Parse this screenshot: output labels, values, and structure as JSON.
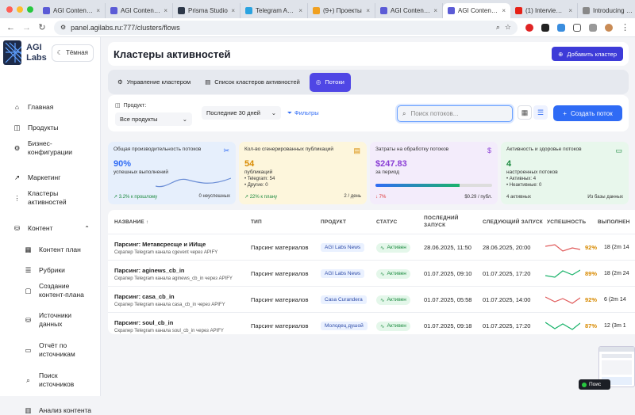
{
  "browser": {
    "tabs": [
      {
        "label": "AGI Content B...",
        "color": "#5b5bd6"
      },
      {
        "label": "AGI Content B...",
        "color": "#5b5bd6"
      },
      {
        "label": "Prisma Studio",
        "color": "#2d3748"
      },
      {
        "label": "Telegram API ...",
        "color": "#2aa3e0"
      },
      {
        "label": "(9+) Проекты",
        "color": "#f0a020"
      },
      {
        "label": "AGI Content B...",
        "color": "#5b5bd6"
      },
      {
        "label": "AGI Content B...",
        "color": "#5b5bd6",
        "active": true
      },
      {
        "label": "(1) Interview wi...",
        "color": "#e62117"
      },
      {
        "label": "Introducing ou...",
        "color": "#888888"
      }
    ],
    "url": "panel.agilabs.ru:777/clusters/flows"
  },
  "sidebar": {
    "brand": [
      "AGI",
      "Labs"
    ],
    "theme_label": "Тёмная",
    "items": [
      {
        "label": "Главная",
        "icon": "home-icon"
      },
      {
        "label": "Продукты",
        "icon": "box-icon"
      },
      {
        "label": "Бизнес-\nконфигурации",
        "icon": "settings-icon"
      },
      {
        "label": "Маркетинг",
        "icon": "trend-icon"
      },
      {
        "label": "Кластеры\nактивностей",
        "icon": "cluster-icon"
      },
      {
        "label": "Контент",
        "icon": "database-icon"
      },
      {
        "label": "Контент план",
        "icon": "calendar-icon",
        "sub": true
      },
      {
        "label": "Рубрики",
        "icon": "list-icon",
        "sub": true
      },
      {
        "label": "Создание\nконтент-плана",
        "icon": "chat-icon",
        "sub": true
      },
      {
        "label": "Источники\nданных",
        "icon": "database-icon",
        "sub": true
      },
      {
        "label": "Отчёт по\nисточникам",
        "icon": "report-icon",
        "sub": true
      },
      {
        "label": "Поиск\nисточников",
        "icon": "search-icon",
        "sub": true
      },
      {
        "label": "Анализ контента",
        "icon": "chart-icon",
        "sub": true
      }
    ]
  },
  "header": {
    "title": "Кластеры активностей",
    "add_button": "Добавить кластер"
  },
  "tabs": [
    {
      "label": "Управление кластером",
      "icon": "gear-icon"
    },
    {
      "label": "Список кластеров активностей",
      "icon": "doc-icon"
    },
    {
      "label": "Потоки",
      "icon": "flow-icon",
      "active": true
    }
  ],
  "filters": {
    "product_label": "Продукт:",
    "product_value": "Все продукты",
    "period_value": "Последние 30 дней",
    "filters_label": "Фильтры",
    "search_placeholder": "Поиск потоков...",
    "create_button": "Создать поток"
  },
  "cards": [
    {
      "title": "Общая производительность потоков",
      "value": "90%",
      "sub": "успешных выполнений",
      "foot_left": "↗ 3.2% к прошлому",
      "foot_right": "0 неуспешных",
      "bg": "#e6effc",
      "accent": "#2f6bf5"
    },
    {
      "title": "Кол-во сгенерированных публикаций",
      "value": "54",
      "sub": "публикаций",
      "lines": [
        "• Telegram: 54",
        "• Другие: 0"
      ],
      "foot_left": "↗ 22% к плану",
      "foot_right": "2 / день",
      "bg": "#fdf6dc",
      "accent": "#d88a00"
    },
    {
      "title": "Затраты на обработку потоков",
      "value": "$247.83",
      "sub": "за период",
      "progress": 0.72,
      "foot_left": "↓ 7%",
      "foot_right": "$0.29 / публ.",
      "bg": "#f3ecfb",
      "accent": "#8b3fd6"
    },
    {
      "title": "Активность и здоровье потоков",
      "value": "4",
      "sub": "настроенных потоков",
      "lines": [
        "• Активных: 4",
        "• Неактивные: 0"
      ],
      "foot_left": "4 активных",
      "foot_right": "Из базы данных",
      "bg": "#e8f7ec",
      "accent": "#1b8a3f"
    }
  ],
  "table": {
    "headers": [
      "НАЗВАНИЕ ↑",
      "ТИП",
      "ПРОДУКТ",
      "СТАТУС",
      "ПОСЛЕДНИЙ ЗАПУСК",
      "СЛЕДУЮЩИЙ ЗАПУСК",
      "УСПЕШНОСТЬ",
      "ВЫПОЛНЕН"
    ],
    "rows": [
      {
        "name": "Парсинг: Метавсресще и ИИще",
        "desc": "Скрапер Telegram канала cgevent через APIFY",
        "type": "Парсинг материалов",
        "product": "AGI Labs News",
        "status": "Активен",
        "last": "28.06.2025, 11:50",
        "next": "28.06.2025, 20:00",
        "success": "92%",
        "done": "18 (2m 14"
      },
      {
        "name": "Парсинг: aginews_cb_in",
        "desc": "Скрапер Telegram канала aginews_cb_in через APIFY",
        "type": "Парсинг материалов",
        "product": "AGI Labs News",
        "status": "Активен",
        "last": "01.07.2025, 09:10",
        "next": "01.07.2025, 17:20",
        "success": "89%",
        "done": "18 (2m 24"
      },
      {
        "name": "Парсинг: casa_cb_in",
        "desc": "Скрапер Telegram канала casa_cb_in через APIFY",
        "type": "Парсинг материалов",
        "product": "Casa Curandera",
        "status": "Активен",
        "last": "01.07.2025, 05:58",
        "next": "01.07.2025, 14:00",
        "success": "92%",
        "done": "6 (2m 14"
      },
      {
        "name": "Парсинг: soul_cb_in",
        "desc": "Скрапер Telegram канала soul_cb_in через APIFY",
        "type": "Парсинг материалов",
        "product": "Молодец душой",
        "status": "Активен",
        "last": "01.07.2025, 09:18",
        "next": "01.07.2025, 17:20",
        "success": "87%",
        "done": "12 (3m 1"
      }
    ]
  },
  "toast": "Поис"
}
